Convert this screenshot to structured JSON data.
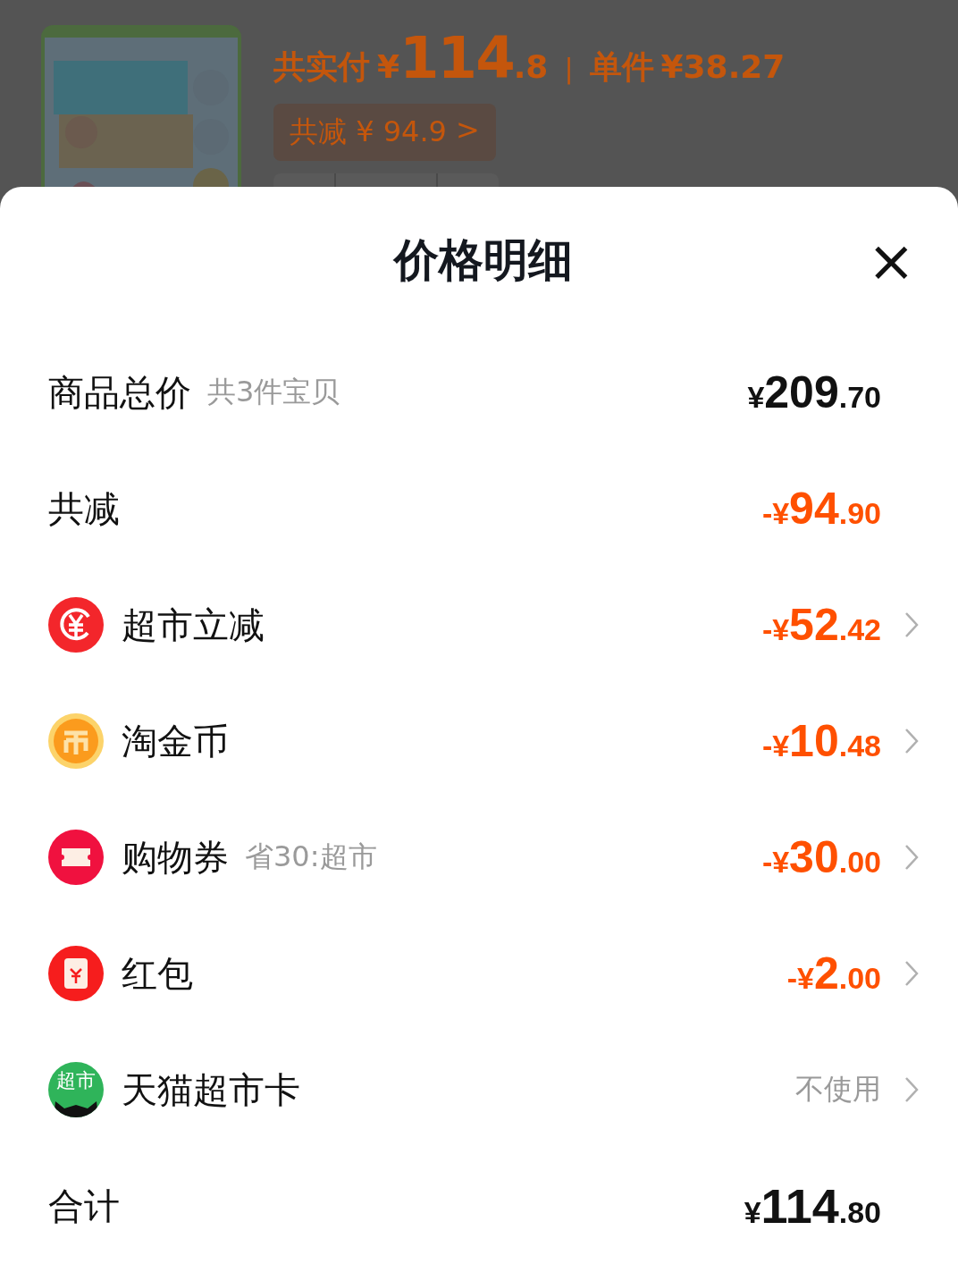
{
  "product": {
    "paid_label": "共实付",
    "paid_currency": "¥",
    "paid_integer": "114",
    "paid_decimal": ".8",
    "separator": "|",
    "unit_label": "单件",
    "unit_price": "¥38.27",
    "discount_chip": "共减 ¥ 94.9",
    "discount_chevron": ">"
  },
  "sheet": {
    "title": "价格明细",
    "close": "×",
    "rows": [
      {
        "kind": "subtotal",
        "label": "商品总价",
        "note": "共3件宝贝",
        "prefix": "¥",
        "integer": "209",
        "decimal": ".70",
        "chevron": false
      },
      {
        "kind": "discount",
        "label": "共减",
        "prefix": "-¥",
        "integer": "94",
        "decimal": ".90",
        "chevron": false
      },
      {
        "kind": "yen",
        "label": "超市立减",
        "prefix": "-¥",
        "integer": "52",
        "decimal": ".42",
        "chevron": true
      },
      {
        "kind": "coin",
        "label": "淘金币",
        "prefix": "-¥",
        "integer": "10",
        "decimal": ".48",
        "chevron": true
      },
      {
        "kind": "ticket",
        "label": "购物券",
        "note": "省30:超市",
        "prefix": "-¥",
        "integer": "30",
        "decimal": ".00",
        "chevron": true
      },
      {
        "kind": "envelope",
        "label": "红包",
        "prefix": "-¥",
        "integer": "2",
        "decimal": ".00",
        "chevron": true
      },
      {
        "kind": "card",
        "icon_text": "超市",
        "label": "天猫超市卡",
        "status": "不使用",
        "chevron": true
      },
      {
        "kind": "total",
        "label": "合计",
        "prefix": "¥",
        "integer": "114",
        "decimal": ".80",
        "chevron": false
      }
    ]
  }
}
